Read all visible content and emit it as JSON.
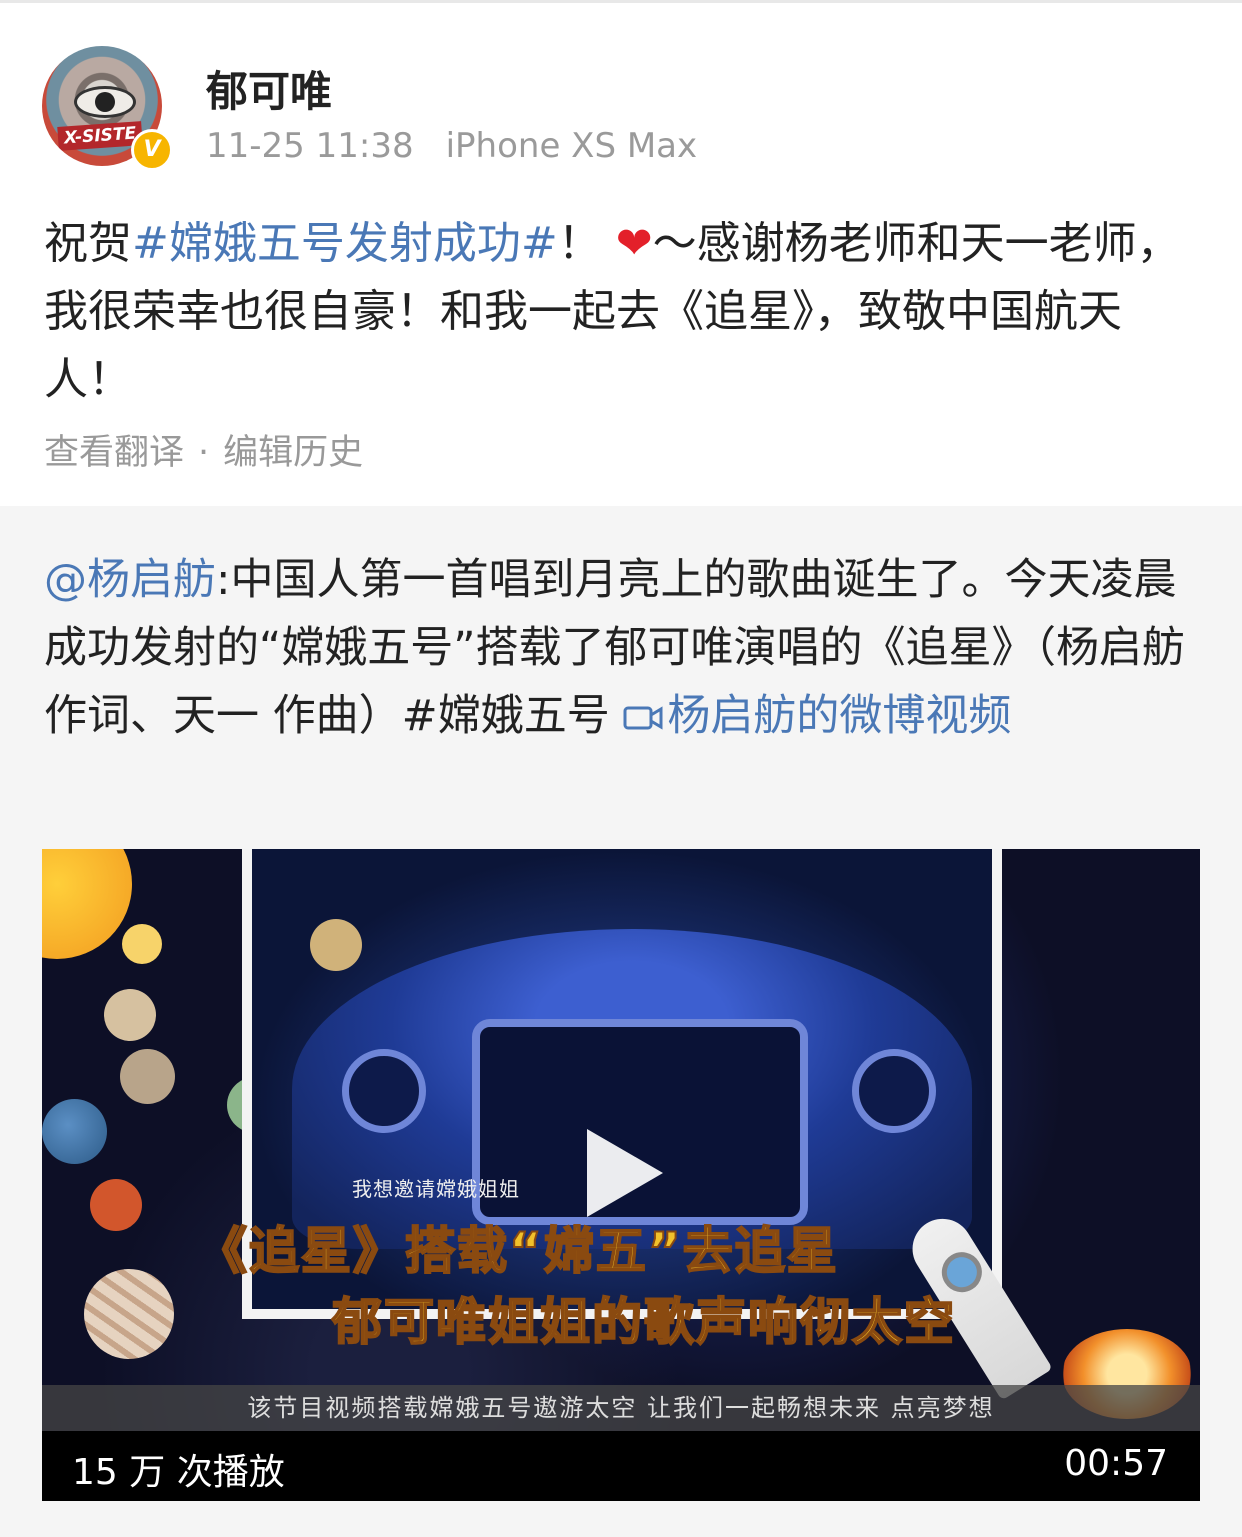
{
  "post": {
    "username": "郁可唯",
    "timestamp": "11-25 11:38",
    "device": "iPhone XS Max",
    "avatar_text": "X-SISTE",
    "verified_badge": "V",
    "text_prefix": "祝贺",
    "hashtag": "#嫦娥五号发射成功#",
    "text_after_hashtag": "！ ",
    "heart": "❤",
    "text_rest": "～感谢杨老师和天一老师，我很荣幸也很自豪！和我一起去《追星》，致敬中国航天人！",
    "translate_link": "查看翻译",
    "separator": "·",
    "edit_history_link": "编辑历史"
  },
  "repost": {
    "mention": "@杨启舫",
    "text": ":中国人第一首唱到月亮上的歌曲诞生了。今天凌晨成功发射的“嫦娥五号”搭载了郁可唯演唱的《追星》（杨启舫作词、天一 作曲）#嫦娥五号 ",
    "video_link_icon": "video-camera-icon",
    "video_link_text": "杨启舫的微博视频"
  },
  "video": {
    "small_subtitle": "我想邀请嫦娥姐姐",
    "caption_line1": "《追星》搭载“嫦五”去追星",
    "caption_line2": "郁可唯姐姐的歌声响彻太空",
    "info_band": "该节目视频搭载嫦娥五号遨游太空 让我们一起畅想未来 点亮梦想",
    "play_count": "15 万 次播放",
    "duration": "00:57"
  },
  "colors": {
    "link": "#4a78b6",
    "caption": "#f2c12b",
    "meta_gray": "#9a9a9a",
    "repost_bg": "#f5f5f5"
  }
}
